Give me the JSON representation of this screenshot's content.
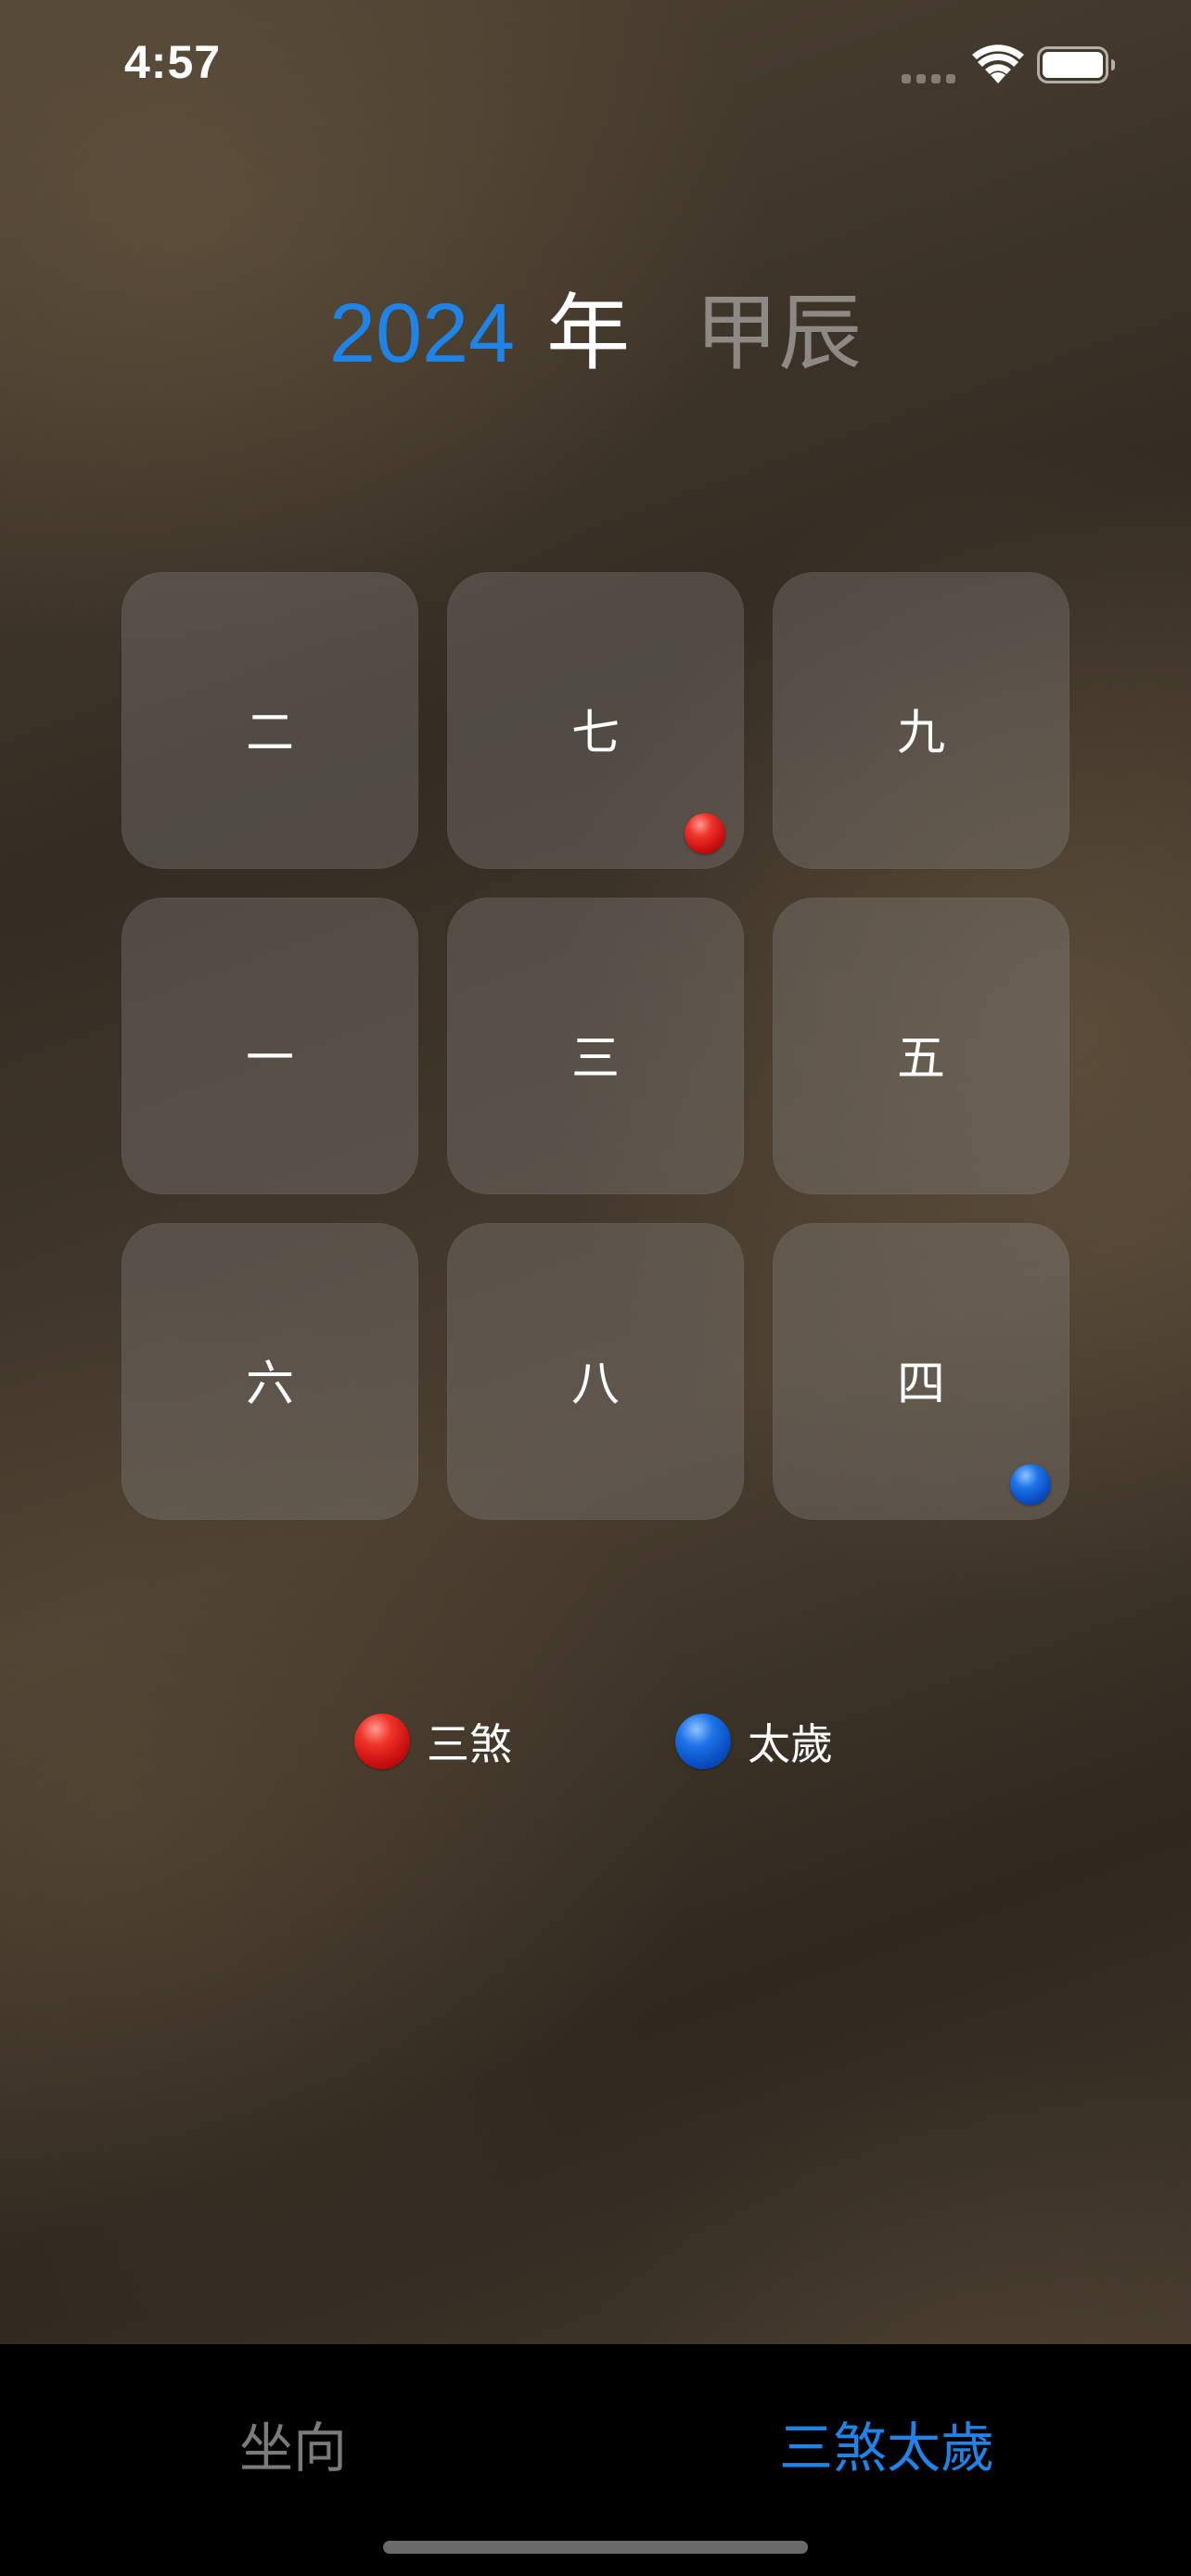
{
  "status_bar": {
    "time": "4:57"
  },
  "header": {
    "year": "2024",
    "year_char": "年",
    "ganzhi": "甲辰"
  },
  "grid": {
    "cells": [
      {
        "label": "二",
        "marker": null
      },
      {
        "label": "七",
        "marker": "三煞"
      },
      {
        "label": "九",
        "marker": null
      },
      {
        "label": "一",
        "marker": null
      },
      {
        "label": "三",
        "marker": null
      },
      {
        "label": "五",
        "marker": null
      },
      {
        "label": "六",
        "marker": null
      },
      {
        "label": "八",
        "marker": null
      },
      {
        "label": "四",
        "marker": "太歲"
      }
    ]
  },
  "legend": {
    "items": [
      {
        "label": "三煞",
        "color": "#e02020",
        "icon": "red-ball-icon"
      },
      {
        "label": "太歲",
        "color": "#1060d8",
        "icon": "blue-ball-icon"
      }
    ]
  },
  "tab_bar": {
    "tabs": [
      {
        "label": "坐向",
        "active": false
      },
      {
        "label": "三煞太歲",
        "active": true
      }
    ],
    "active_color": "#1e84e8"
  },
  "colors": {
    "accent": "#1e84e8",
    "ganzhi_text": "#8d8a86"
  }
}
